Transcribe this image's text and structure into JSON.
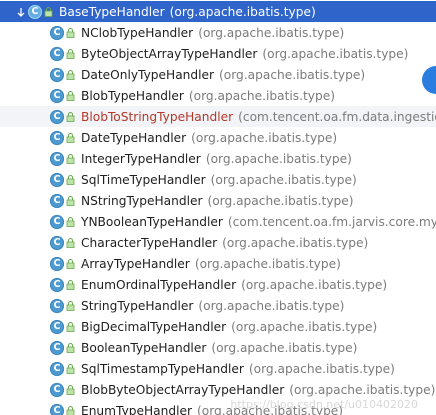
{
  "root": {
    "name": "BaseTypeHandler",
    "pkg": "(org.apache.ibatis.type)"
  },
  "items": [
    {
      "name": "NClobTypeHandler",
      "pkg": "(org.apache.ibatis.type)"
    },
    {
      "name": "ByteObjectArrayTypeHandler",
      "pkg": "(org.apache.ibatis.type)"
    },
    {
      "name": "DateOnlyTypeHandler",
      "pkg": "(org.apache.ibatis.type)"
    },
    {
      "name": "BlobTypeHandler",
      "pkg": "(org.apache.ibatis.type)"
    },
    {
      "name": "BlobToStringTypeHandler",
      "pkg": "(com.tencent.oa.fm.data.ingestion."
    },
    {
      "name": "DateTypeHandler",
      "pkg": "(org.apache.ibatis.type)"
    },
    {
      "name": "IntegerTypeHandler",
      "pkg": "(org.apache.ibatis.type)"
    },
    {
      "name": "SqlTimeTypeHandler",
      "pkg": "(org.apache.ibatis.type)"
    },
    {
      "name": "NStringTypeHandler",
      "pkg": "(org.apache.ibatis.type)"
    },
    {
      "name": "YNBooleanTypeHandler",
      "pkg": "(com.tencent.oa.fm.jarvis.core.myba"
    },
    {
      "name": "CharacterTypeHandler",
      "pkg": "(org.apache.ibatis.type)"
    },
    {
      "name": "ArrayTypeHandler",
      "pkg": "(org.apache.ibatis.type)"
    },
    {
      "name": "EnumOrdinalTypeHandler",
      "pkg": "(org.apache.ibatis.type)"
    },
    {
      "name": "StringTypeHandler",
      "pkg": "(org.apache.ibatis.type)"
    },
    {
      "name": "BigDecimalTypeHandler",
      "pkg": "(org.apache.ibatis.type)"
    },
    {
      "name": "BooleanTypeHandler",
      "pkg": "(org.apache.ibatis.type)"
    },
    {
      "name": "SqlTimestampTypeHandler",
      "pkg": "(org.apache.ibatis.type)"
    },
    {
      "name": "BlobByteObjectArrayTypeHandler",
      "pkg": "(org.apache.ibatis.type)"
    },
    {
      "name": "EnumTypeHandler",
      "pkg": "(org.apache.ibatis.type)"
    }
  ],
  "icon_letter": "C",
  "watermark": "https://blog.csdn.net/u010402020",
  "colors": {
    "selection": "#2f65ca",
    "class_icon": "#4d9bd0",
    "highlight_text": "#b23a2a",
    "package_text": "#7b7b7b"
  }
}
